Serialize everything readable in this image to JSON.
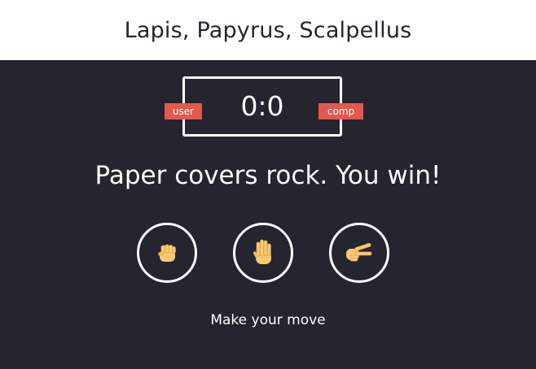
{
  "header": {
    "title": "Lapis, Papyrus, Scalpellus"
  },
  "scoreboard": {
    "score": "0:0",
    "user_label": "user",
    "comp_label": "comp"
  },
  "result": {
    "message": "Paper covers rock. You win!"
  },
  "choices": [
    {
      "id": "rock",
      "icon": "fist-icon"
    },
    {
      "id": "paper",
      "icon": "raised-hand-icon"
    },
    {
      "id": "scissors",
      "icon": "victory-hand-icon"
    }
  ],
  "action": {
    "prompt": "Make your move"
  },
  "colors": {
    "background": "#25252f",
    "header_background": "#ffffff",
    "badge": "#e2584d",
    "text": "#ffffff",
    "skin": "#fbc975"
  }
}
